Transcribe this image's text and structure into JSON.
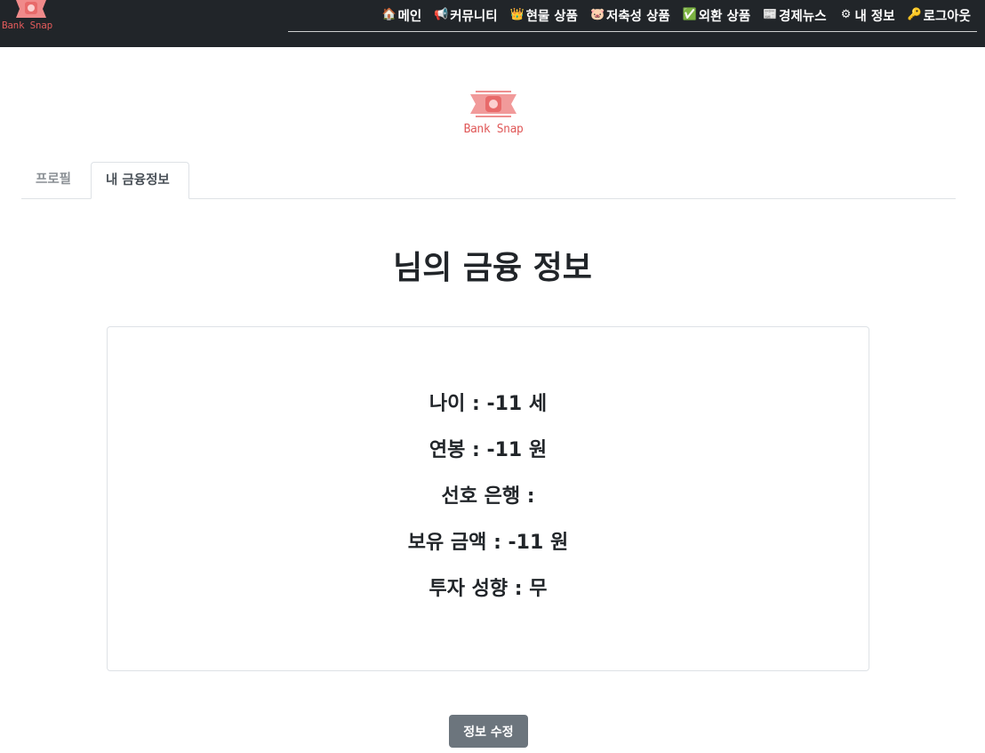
{
  "brand": {
    "name": "Bank Snap",
    "accent_color": "#e05a5a"
  },
  "nav": {
    "items": [
      {
        "icon": "house-icon",
        "glyph": "🏠",
        "label": "메인"
      },
      {
        "icon": "megaphone-icon",
        "glyph": "📢",
        "label": "커뮤니티"
      },
      {
        "icon": "crown-icon",
        "glyph": "👑",
        "label": "현물 상품"
      },
      {
        "icon": "pig-icon",
        "glyph": "🐷",
        "label": "저축성 상품"
      },
      {
        "icon": "check-icon",
        "glyph": "✅",
        "label": "외환 상품"
      },
      {
        "icon": "newspaper-icon",
        "glyph": "📰",
        "label": "경제뉴스"
      },
      {
        "icon": "gear-icon",
        "glyph": "⚙",
        "label": "내 정보"
      },
      {
        "icon": "key-icon",
        "glyph": "🔑",
        "label": "로그아웃"
      }
    ]
  },
  "tabs": [
    {
      "label": "프로필",
      "active": false
    },
    {
      "label": "내 금융정보",
      "active": true
    }
  ],
  "page_title": "님의 금융 정보",
  "info": {
    "age": "나이 : -11 세",
    "salary": "연봉 : -11 원",
    "preferred_bank": "선호 은행 :",
    "balance": "보유 금액 : -11 원",
    "investment_style": "투자 성향 : 무"
  },
  "edit_button_label": "정보 수정"
}
